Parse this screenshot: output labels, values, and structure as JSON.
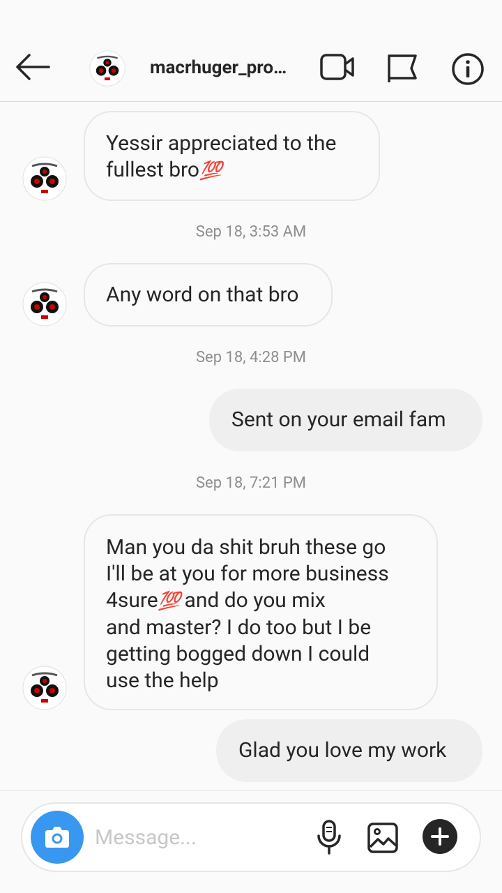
{
  "header": {
    "username": "macrhuger_pro…",
    "icons": [
      "back-arrow-icon",
      "video-call-icon",
      "flag-icon",
      "info-icon"
    ]
  },
  "messages": [
    {
      "direction": "incoming",
      "line1": "Yessir appreciated to the",
      "line2": "fullest bro",
      "emoji": "💯"
    },
    {
      "timestamp": "Sep 18, 3:53 AM"
    },
    {
      "direction": "incoming",
      "text": "Any word on that bro"
    },
    {
      "timestamp": "Sep 18, 4:28 PM"
    },
    {
      "direction": "outgoing",
      "text": "Sent on your email fam"
    },
    {
      "timestamp": "Sep 18, 7:21 PM"
    },
    {
      "direction": "incoming",
      "line1": "Man you da shit bruh these go",
      "line2": "I'll be at you for more business",
      "line3a": "4sure",
      "emoji": "💯",
      "line3b": " and do you mix",
      "line4": "and master? I do too but I be",
      "line5": "getting bogged down I could",
      "line6": "use the help"
    },
    {
      "direction": "outgoing",
      "text": "Glad you love my work"
    }
  ],
  "composer": {
    "placeholder": "Message...",
    "icons": [
      "camera-icon",
      "microphone-icon",
      "gallery-icon",
      "plus-icon"
    ]
  },
  "colors": {
    "accent": "#3897f0",
    "background": "#fafafa",
    "outgoing_bubble": "#efefef",
    "timestamp": "#8e8e8e"
  }
}
